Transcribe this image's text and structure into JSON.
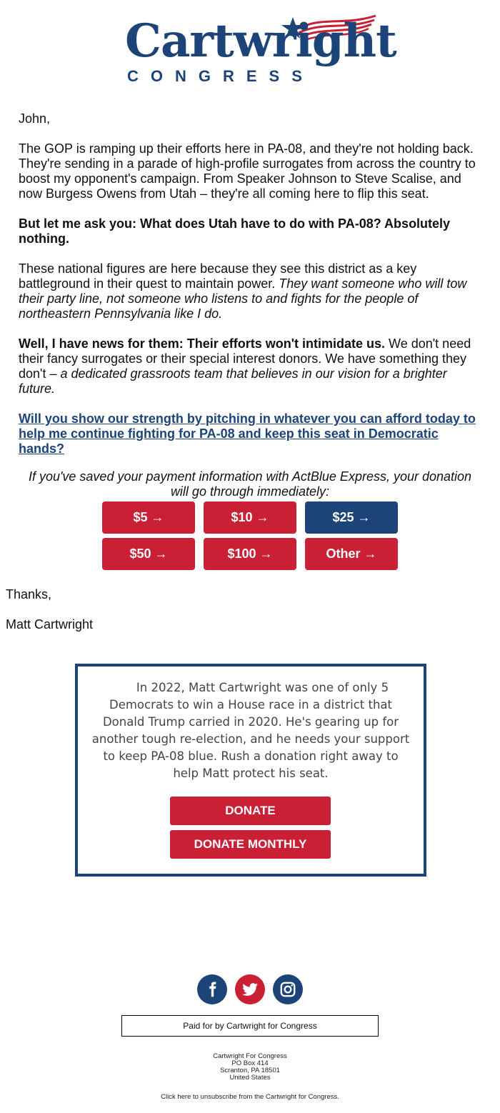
{
  "header": {
    "logo_word": "Cartwright",
    "logo_sub": "CONGRESS"
  },
  "letter": {
    "greeting": "John,",
    "p1": "The GOP is ramping up their efforts here in PA-08, and they're not holding back. They're sending in a parade of high-profile surrogates from across the country to boost my opponent's campaign. From Speaker Johnson to Steve Scalise, and now Burgess Owens from Utah – they're all coming here to flip this seat.",
    "p2": "But let me ask you: What does Utah have to do with PA-08? Absolutely nothing.",
    "p3_plain": "These national figures are here because they see this district as a key battleground in their quest to maintain power. ",
    "p3_italic": "They want someone who will tow their party line, not someone who listens to and fights for the people of northeastern Pennsylvania like I do.",
    "p4_bold": "Well, I have news for them: Their efforts won't intimidate us.",
    "p4_plain": " We don't need their fancy surrogates or their special interest donors. We have something they don't – ",
    "p4_italic": "a dedicated grassroots team that believes in our vision for a brighter future.",
    "cta_link": "Will you show our strength by pitching in whatever you can afford today to help me continue fighting for PA-08 and keep this seat in Democratic hands?",
    "express_note": "If you've saved your payment information with ActBlue Express, your donation will go through immediately:",
    "signoff": "Thanks,",
    "signature": "Matt Cartwright"
  },
  "amount_buttons": [
    {
      "label": "$5 →",
      "color": "#c92035"
    },
    {
      "label": "$10 →",
      "color": "#c92035"
    },
    {
      "label": "$25 →",
      "color": "#1d4479"
    },
    {
      "label": "$50 →",
      "color": "#c92035"
    },
    {
      "label": "$100 →",
      "color": "#c92035"
    },
    {
      "label": "Other →",
      "color": "#c92035"
    }
  ],
  "promo": {
    "text": "In 2022, Matt Cartwright was one of only 5 Democrats to win a House race in a district that Donald Trump carried in 2020. He's gearing up for another tough re-election, and he needs your support to keep PA-08 blue. Rush a donation right away to help Matt protect his seat.",
    "donate_label": "DONATE",
    "donate_monthly_label": "DONATE MONTHLY"
  },
  "social": [
    {
      "icon": "facebook-icon",
      "color": "#1d4479"
    },
    {
      "icon": "twitter-icon",
      "color": "#c92035"
    },
    {
      "icon": "instagram-icon",
      "color": "#1d4479"
    }
  ],
  "footer": {
    "paid_for": "Paid for by Cartwright for Congress",
    "address_lines": [
      "Cartwright For Congress",
      "PO Box 414",
      "Scranton, PA 18501",
      "United States"
    ],
    "unsubscribe": "Click here to unsubscribe from the Cartwright for Congress."
  },
  "colors": {
    "brand_blue": "#1d4479",
    "brand_red": "#c92035"
  }
}
